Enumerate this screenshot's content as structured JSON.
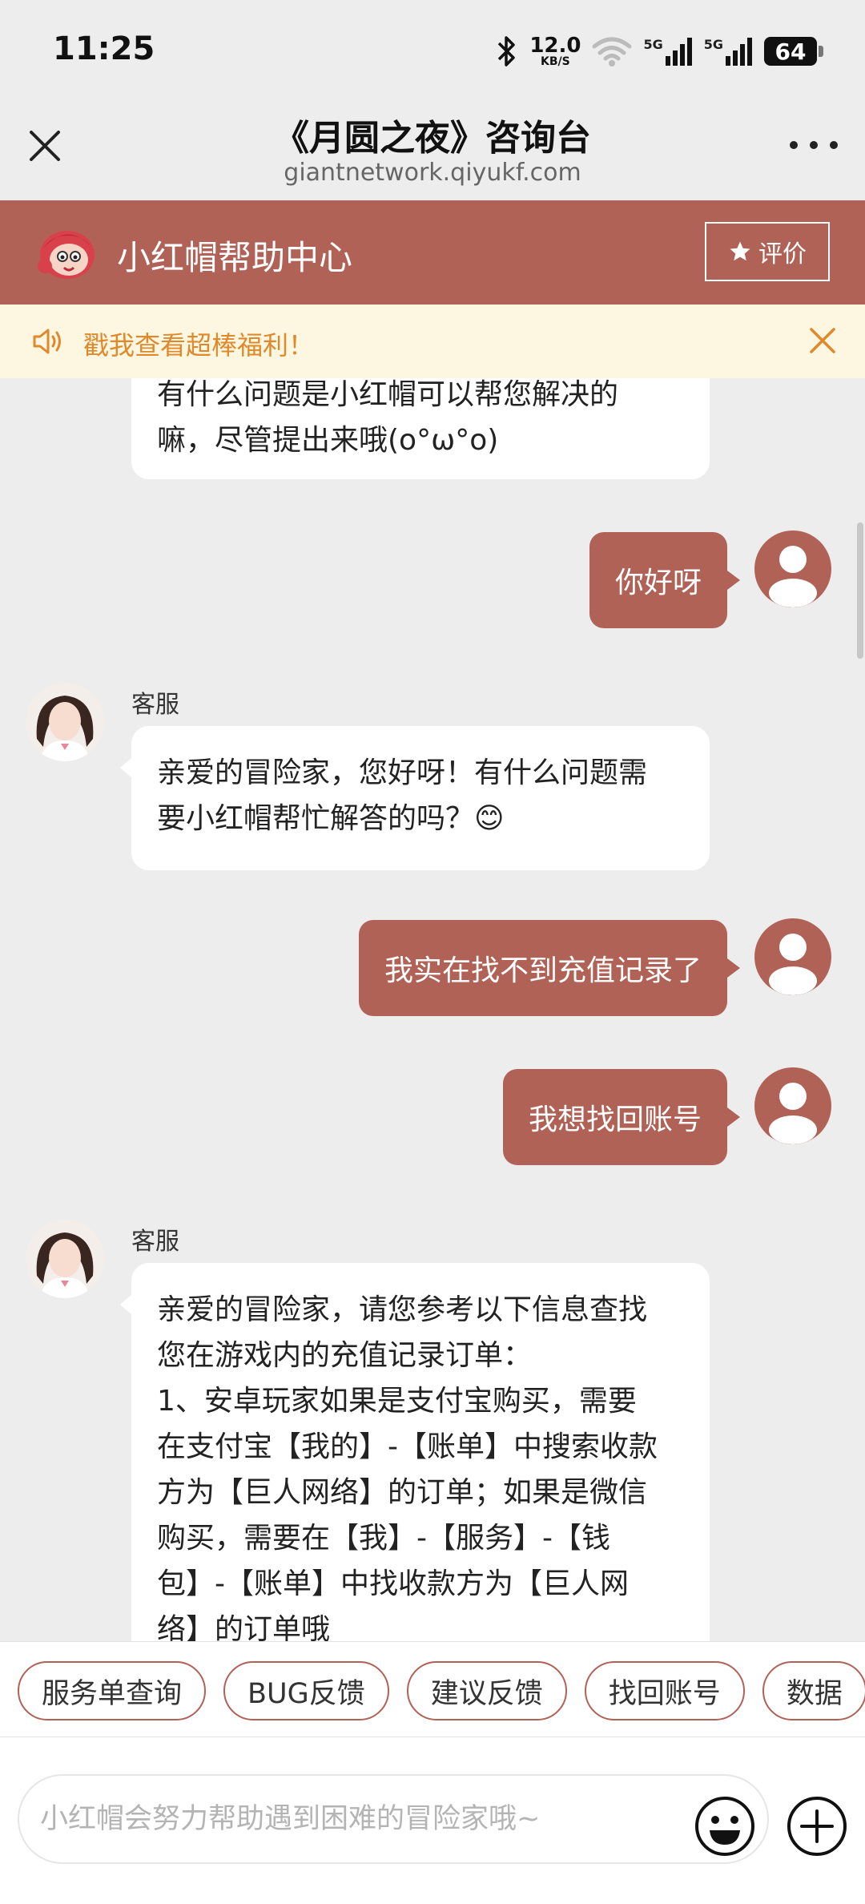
{
  "status_bar": {
    "time": "11:25",
    "net_speed_value": "12.0",
    "net_speed_unit": "KB/S",
    "signal1_label": "5G",
    "signal2_label": "5G",
    "battery": "64"
  },
  "title_bar": {
    "title": "《月圆之夜》咨询台",
    "url": "giantnetwork.qiyukf.com"
  },
  "brand": {
    "title": "小红帽帮助中心",
    "rate_label": "评价",
    "color": "#b06257"
  },
  "notice": {
    "text": "戳我查看超棒福利！",
    "color": "#e0892a"
  },
  "messages": {
    "m0_line1": "有什么问题是小红帽可以帮您解决的",
    "m0_line2": "嘛，尽管提出来哦(o°ω°o)",
    "m1": "你好呀",
    "m2_name": "客服",
    "m2_line1": "亲爱的冒险家，您好呀！有什么问题需",
    "m2_line2": "要小红帽帮忙解答的吗？😊",
    "m3": "我实在找不到充值记录了",
    "m4": "我想找回账号",
    "m5_name": "客服",
    "m5_lines": [
      "亲爱的冒险家，请您参考以下信息查找",
      "您在游戏内的充值记录订单：",
      "1、安卓玩家如果是支付宝购买，需要",
      "在支付宝【我的】-【账单】中搜索收款",
      "方为【巨人网络】的订单；如果是微信",
      "购买，需要在【我】-【服务】-【钱",
      "包】-【账单】中找收款方为【巨人网",
      "络】的订单哦"
    ]
  },
  "quick_chips": [
    "服务单查询",
    "BUG反馈",
    "建议反馈",
    "找回账号",
    "数据"
  ],
  "input": {
    "placeholder": "小红帽会努力帮助遇到困难的冒险家哦~",
    "value": ""
  }
}
